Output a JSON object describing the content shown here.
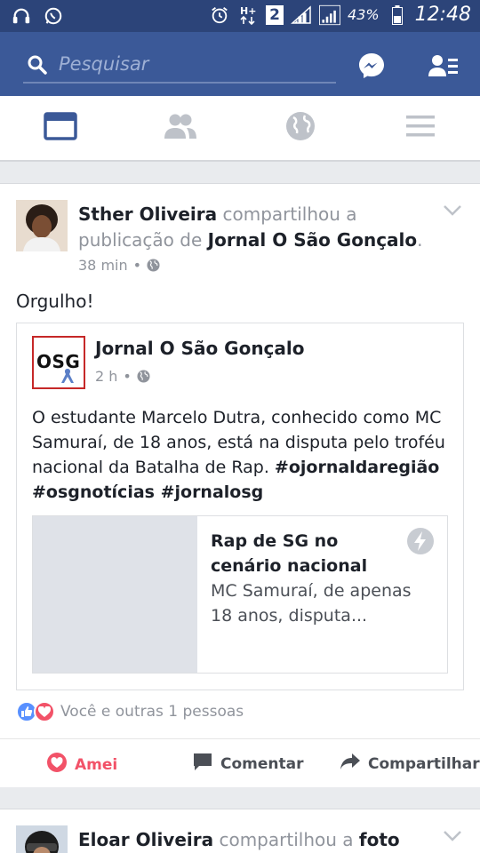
{
  "status_bar": {
    "battery": "43%",
    "time": "12:48",
    "network": "2"
  },
  "search": {
    "placeholder": "Pesquisar"
  },
  "post1": {
    "author": "Sther Oliveira",
    "action_text": "compartilhou a publicação de",
    "shared_page": "Jornal O São Gonçalo",
    "time": "38 min",
    "text": "Orgulho!",
    "shared": {
      "logo_text": "OSG",
      "page_name": "Jornal O São Gonçalo",
      "time": "2 h",
      "body": "O estudante Marcelo Dutra, conhecido como MC Samuraí, de 18 anos, está na disputa pelo troféu nacional da Batalha de Rap.",
      "hashtags": "#ojornaldaregião #osgnotícias #jornalosg",
      "link": {
        "title": "Rap de SG no cenário nacional",
        "description": "MC Samuraí, de apenas 18 anos, disputa..."
      }
    },
    "reactions_text": "Você e outras 1 pessoas",
    "actions": {
      "love": "Amei",
      "comment": "Comentar",
      "share": "Compartilhar"
    }
  },
  "post2": {
    "author": "Eloar Oliveira",
    "action_text": "compartilhou a",
    "object": "foto"
  },
  "colors": {
    "brand": "#3b5998",
    "status_bar": "#2c4479",
    "love": "#f25268",
    "like": "#5890ff"
  }
}
